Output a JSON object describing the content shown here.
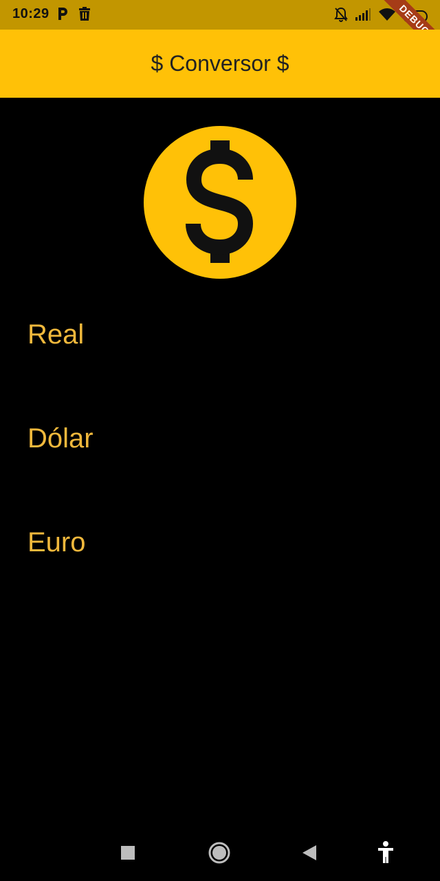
{
  "status_bar": {
    "time": "10:29",
    "battery_level": "71",
    "background": "#C29600",
    "icons": [
      "parking-icon",
      "trash-icon",
      "bell-off-icon",
      "signal-icon",
      "wifi-icon",
      "battery-icon"
    ]
  },
  "debug_banner": "DEBUG",
  "app_bar": {
    "title": "$ Conversor $",
    "background": "#FFC107"
  },
  "main": {
    "icon": "monetization-coin-icon",
    "accent": "#FFC107",
    "label_color": "#F0B83C",
    "fields": [
      {
        "label": "Real"
      },
      {
        "label": "Dólar"
      },
      {
        "label": "Euro"
      }
    ]
  },
  "nav_bar": {
    "icons": [
      "recents-square-icon",
      "home-circle-icon",
      "back-triangle-icon",
      "accessibility-icon"
    ]
  }
}
